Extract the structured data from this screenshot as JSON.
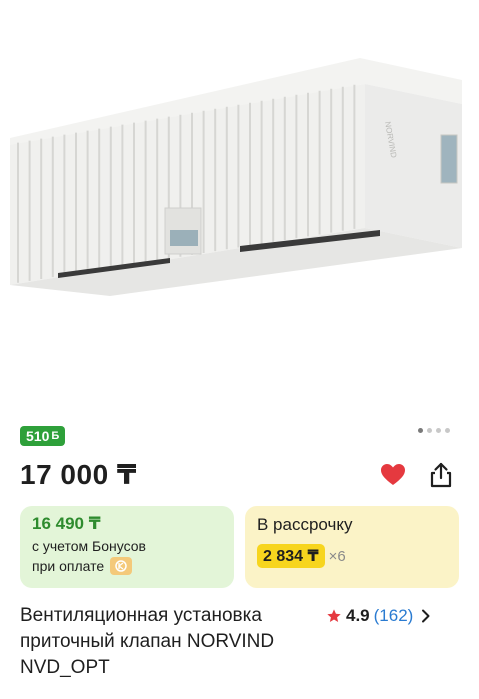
{
  "product": {
    "bonus_badge": "510",
    "bonus_badge_icon": "Б",
    "price": "17 000 ₸",
    "bonus_price": {
      "price": "16 490 ₸",
      "line1": "с учетом Бонусов",
      "line2": "при оплате"
    },
    "installment": {
      "title": "В рассрочку",
      "amount": "2 834 ₸",
      "multiplier": "×6"
    },
    "title": "Вентиляционная установка приточный клапан NORVIND NVD_OPT",
    "rating": {
      "value": "4.9",
      "count": "(162)"
    },
    "brand_on_image": "NORVIND"
  },
  "gallery": {
    "dots": 4,
    "active_dot": 0
  },
  "icons": {
    "favorite": "heart-icon",
    "share": "share-icon",
    "pay": "kaspi-pay-icon",
    "star": "star-icon",
    "chevron": "chevron-right-icon"
  },
  "colors": {
    "bonus_green": "#2ea03a",
    "bonus_card_bg": "#e3f5d8",
    "installment_bg": "#fbf3c7",
    "installment_highlight": "#f7d51e",
    "heart_red": "#e5393f",
    "star_red": "#e5393f",
    "rating_count_blue": "#2a7bd1"
  }
}
